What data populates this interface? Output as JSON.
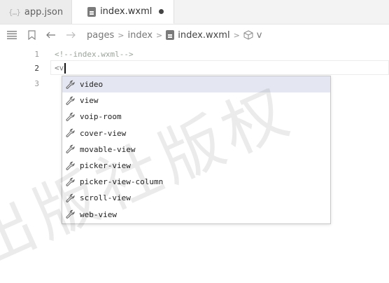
{
  "tabs": [
    {
      "label": "app.json",
      "icon": "json-braces-icon",
      "active": false
    },
    {
      "label": "index.wxml",
      "icon": "wxml-file-icon",
      "active": true,
      "dirty": true
    }
  ],
  "breadcrumb": {
    "items": [
      "pages",
      "index",
      "index.wxml",
      "v"
    ]
  },
  "editor": {
    "lines": [
      {
        "number": "1",
        "text": "<!--index.wxml-->"
      },
      {
        "number": "2",
        "text": "<v"
      },
      {
        "number": "3",
        "text": ""
      }
    ]
  },
  "suggestions": [
    {
      "label": "video",
      "selected": true
    },
    {
      "label": "view"
    },
    {
      "label": "voip-room"
    },
    {
      "label": "cover-view"
    },
    {
      "label": "movable-view"
    },
    {
      "label": "picker-view"
    },
    {
      "label": "picker-view-column"
    },
    {
      "label": "scroll-view"
    },
    {
      "label": "web-view"
    }
  ],
  "watermark": "出版社版权"
}
